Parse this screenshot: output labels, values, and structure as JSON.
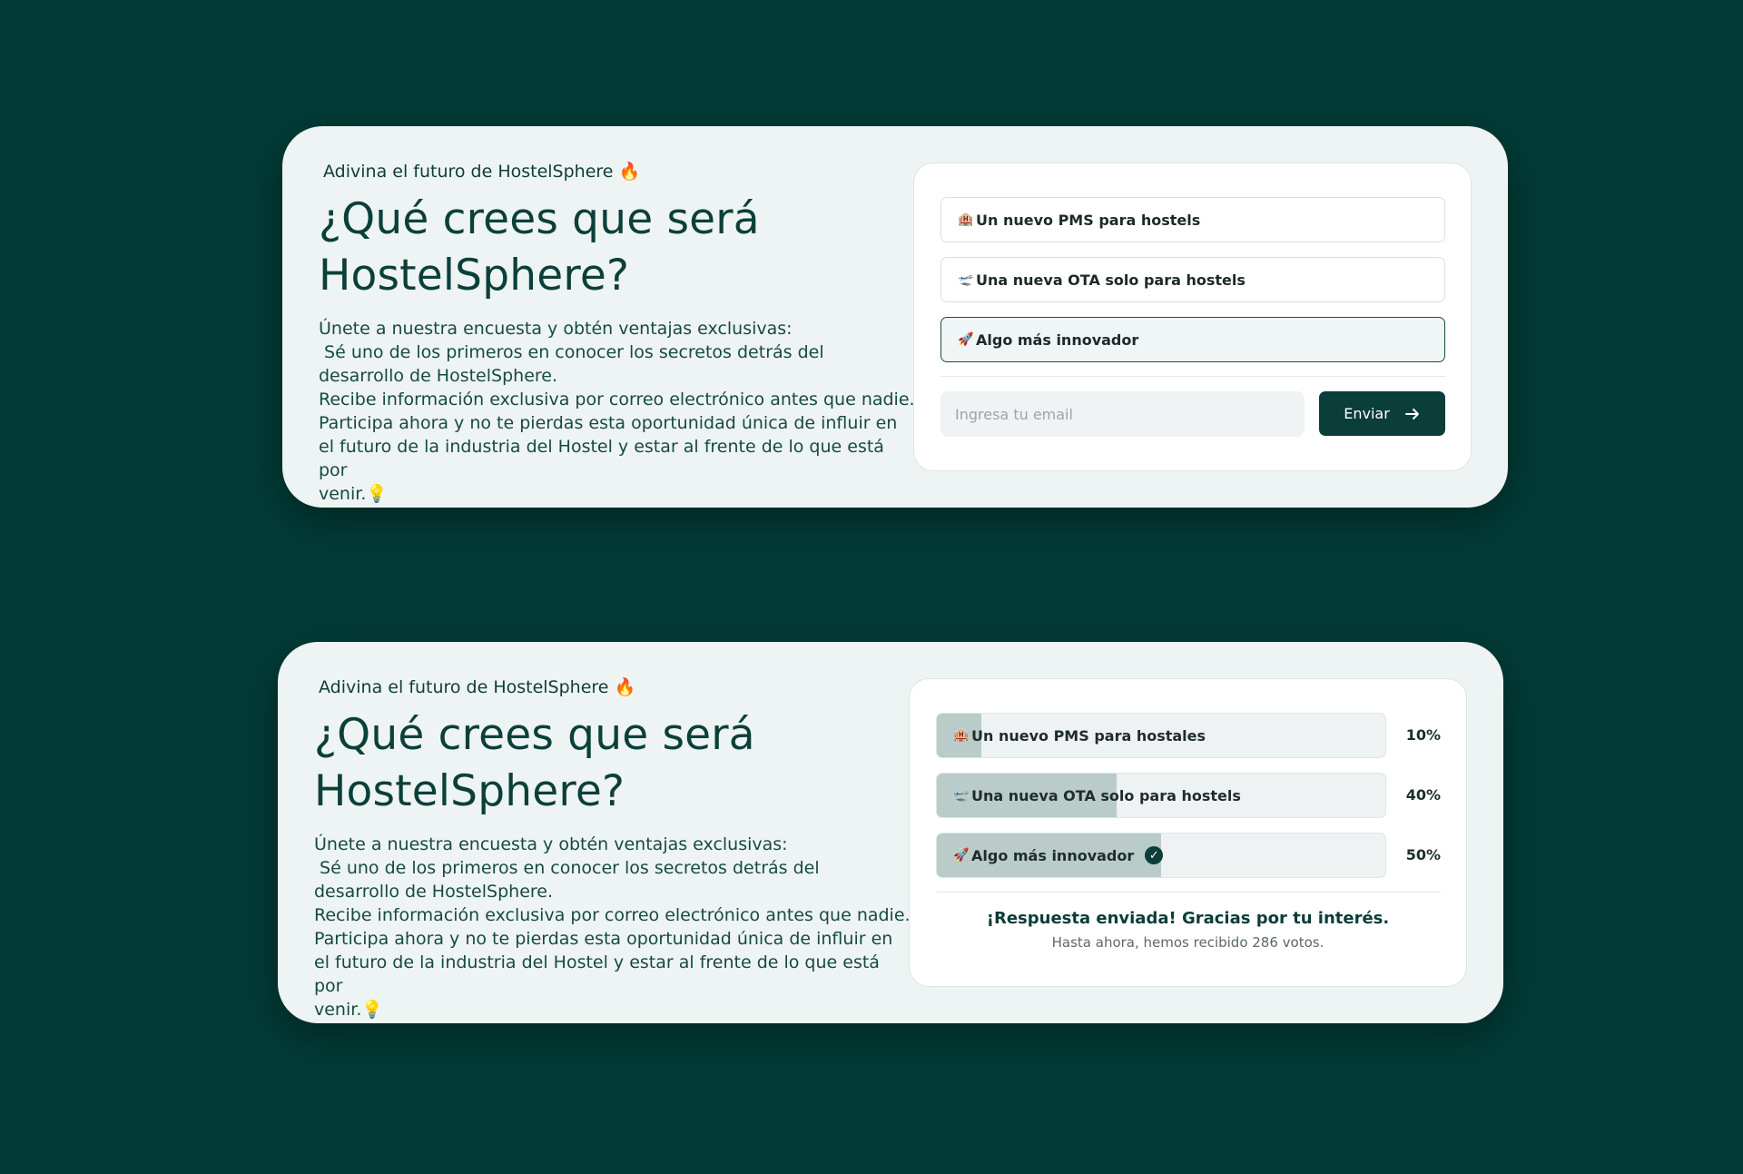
{
  "eyebrow": "Adivina el futuro de HostelSphere 🔥",
  "title_line1": "¿Qué crees que será",
  "title_line2": "HostelSphere?",
  "body_lines": [
    "Únete a nuestra encuesta y obtén ventajas exclusivas:",
    " Sé uno de los primeros en conocer los secretos detrás del",
    "desarrollo de HostelSphere.",
    "Recibe información exclusiva por correo electrónico antes que nadie.",
    "Participa ahora y no te pierdas esta oportunidad única de influir en",
    "el futuro de la industria del Hostel y estar al frente de lo que está por",
    "venir.💡"
  ],
  "form": {
    "options": [
      {
        "emoji": "🏨",
        "label": "Un nuevo PMS para hostels",
        "selected": false,
        "icon": "hotel-icon"
      },
      {
        "emoji": "🛫",
        "label": "Una nueva OTA solo para hostels",
        "selected": false,
        "icon": "airplane-icon"
      },
      {
        "emoji": "🚀",
        "label": "Algo más innovador",
        "selected": true,
        "icon": "rocket-icon"
      }
    ],
    "email_placeholder": "Ingresa tu email",
    "email_value": "",
    "submit_label": "Enviar",
    "submit_icon": "arrow-right-icon"
  },
  "results": {
    "options": [
      {
        "emoji": "🏨",
        "label": "Un nuevo PMS para hostales",
        "percent_label": "10%",
        "percent": 10,
        "chosen": false
      },
      {
        "emoji": "🛫",
        "label": "Una nueva OTA solo para hostels",
        "percent_label": "40%",
        "percent": 40,
        "chosen": false
      },
      {
        "emoji": "🚀",
        "label": "Algo más innovador",
        "percent_label": "50%",
        "percent": 50,
        "chosen": true
      }
    ],
    "check_icon": "check-circle-icon",
    "thanks": "¡Respuesta enviada! Gracias por tu interés.",
    "votes_text": "Hasta ahora, hemos recibido 286 votos."
  },
  "colors": {
    "background": "#023b36",
    "card": "#eef4f3",
    "primary": "#0b3d39",
    "bar_fill": "#b9ccca"
  }
}
